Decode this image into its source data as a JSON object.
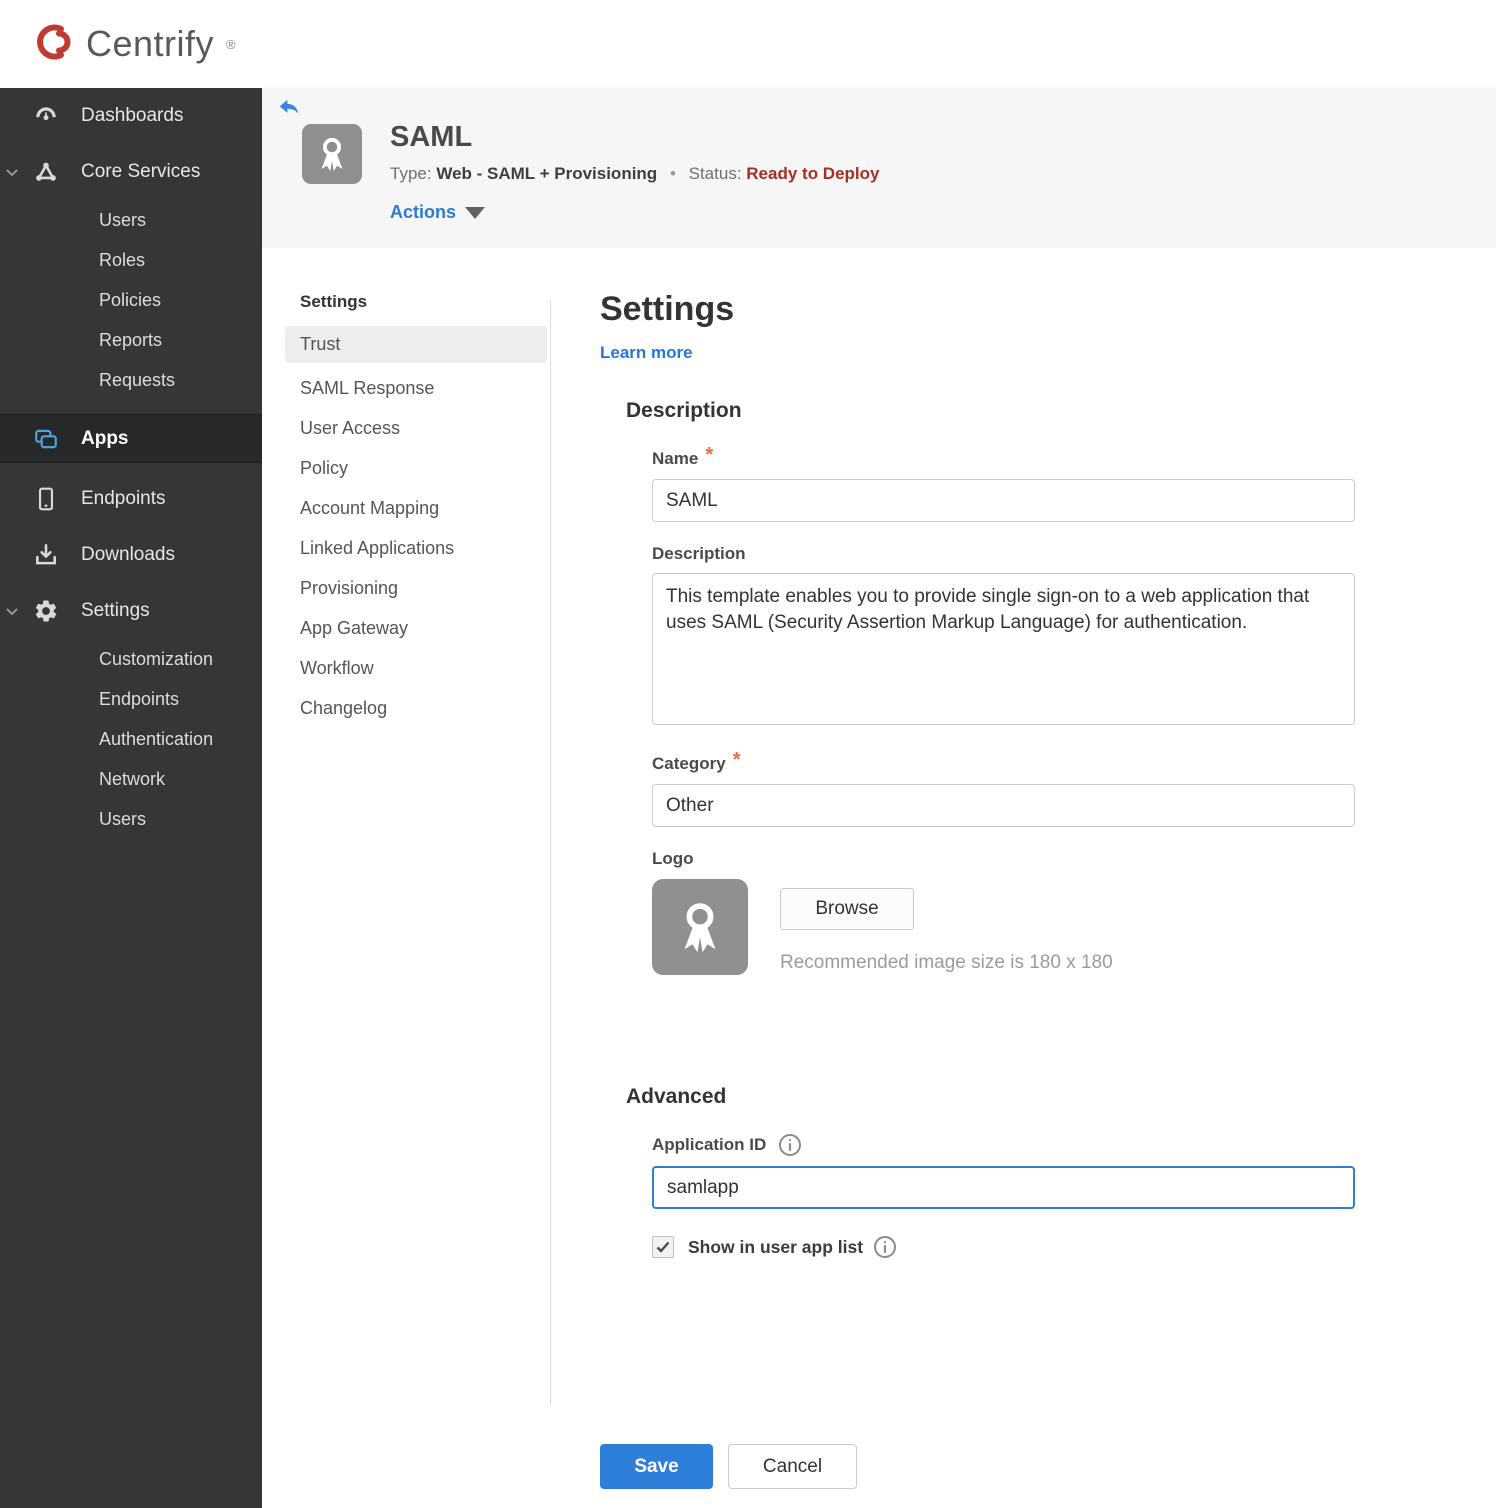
{
  "brand": {
    "name": "Centrify",
    "registered": "®"
  },
  "sidebar": {
    "items": [
      {
        "label": "Dashboards",
        "icon": "gauge-icon"
      },
      {
        "label": "Core Services",
        "icon": "core-services-icon",
        "expanded": true,
        "children": [
          "Users",
          "Roles",
          "Policies",
          "Reports",
          "Requests"
        ]
      },
      {
        "label": "Apps",
        "icon": "apps-icon",
        "active": true
      },
      {
        "label": "Endpoints",
        "icon": "device-icon"
      },
      {
        "label": "Downloads",
        "icon": "download-icon"
      },
      {
        "label": "Settings",
        "icon": "gear-icon",
        "expanded": true,
        "children": [
          "Customization",
          "Endpoints",
          "Authentication",
          "Network",
          "Users"
        ]
      }
    ]
  },
  "header": {
    "title": "SAML",
    "type_label": "Type:",
    "type_value": "Web - SAML + Provisioning",
    "separator": "•",
    "status_label": "Status:",
    "status_value": "Ready to Deploy",
    "actions_label": "Actions"
  },
  "subnav": {
    "heading": "Settings",
    "selected": "Trust",
    "items": [
      "Trust",
      "SAML Response",
      "User Access",
      "Policy",
      "Account Mapping",
      "Linked Applications",
      "Provisioning",
      "App Gateway",
      "Workflow",
      "Changelog"
    ]
  },
  "main": {
    "title": "Settings",
    "learn_more": "Learn more",
    "required_marker": "*",
    "description_section": {
      "heading": "Description",
      "name_label": "Name",
      "name_value": "SAML",
      "description_label": "Description",
      "description_value": "This template enables you to provide single sign-on to a web application that uses SAML (Security Assertion Markup Language) for authentication.",
      "category_label": "Category",
      "category_value": "Other",
      "logo_label": "Logo",
      "browse_label": "Browse",
      "logo_hint": "Recommended image size is 180 x 180"
    },
    "advanced_section": {
      "heading": "Advanced",
      "app_id_label": "Application ID",
      "app_id_value": "samlapp",
      "show_in_app_list_label": "Show in user app list",
      "show_in_app_list_checked": true
    },
    "buttons": {
      "save": "Save",
      "cancel": "Cancel"
    }
  },
  "colors": {
    "accent_blue": "#2e7fd9",
    "link_blue": "#2676d9",
    "status_red": "#a52e22",
    "required_orange": "#ee6c3a",
    "sidebar_bg": "#343638",
    "sidebar_active_bg": "#262829",
    "apps_icon_blue": "#4da3dc",
    "header_band_bg": "#f6f6f6",
    "selected_item_bg": "#ededed",
    "brand_red": "#bf3a31"
  }
}
